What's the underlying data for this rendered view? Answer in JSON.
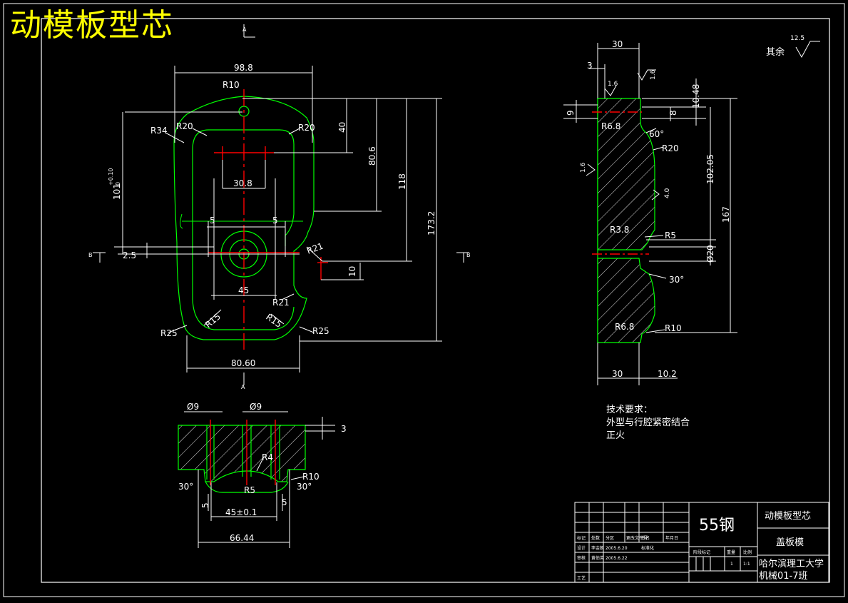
{
  "heading": "动模板型芯",
  "front_view": {
    "dims": {
      "width_top": "98.8",
      "r_top": "R10",
      "r34": "R34",
      "r20_left": "R20",
      "r20_right": "R20",
      "d40": "40",
      "d80_6": "80.6",
      "d118": "118",
      "d173_2": "173.2",
      "tol_height": "101",
      "tol_upper": "+0.10",
      "tol_lower": "0",
      "d30_8": "30.8",
      "d5_left": "5",
      "d5_right": "5",
      "d2_5": "2.5",
      "r21_upper": "R21",
      "d10": "10",
      "d45": "45",
      "r21_lower": "R21",
      "r15_left": "R15",
      "r15_right": "R15",
      "r25_left": "R25",
      "r25_right": "R25",
      "width_bottom": "80.60"
    },
    "section_marks": {
      "top": "A",
      "bottom": "A",
      "left": "B",
      "right": "B"
    }
  },
  "bottom_view": {
    "dims": {
      "dia9_left": "Ø9",
      "dia9_right": "Ø9",
      "d3": "3",
      "r4": "R4",
      "r5": "R5",
      "r10": "R10",
      "angle_left": "30°",
      "angle_right": "30°",
      "d5_left": "5",
      "d5_right": "5",
      "d45_tol": "45±0.1",
      "d66_44": "66.44"
    }
  },
  "side_view": {
    "dims": {
      "d30_top": "30",
      "d3": "3",
      "rough_1_6_top": "1.6",
      "rough_1_6_left": "1.6",
      "rough_1_6_right": "1.6",
      "rough_4_0": "4.0",
      "d9": "9",
      "d8": "8",
      "d10_48": "10.48",
      "r6_8_top": "R6.8",
      "angle_60": "60°",
      "r20": "R20",
      "d102_05": "102.05",
      "d167": "167",
      "r3_8": "R3.8",
      "r5": "R5",
      "dia20": "Ø20",
      "angle_30": "30°",
      "r6_8_bottom": "R6.8",
      "r10": "R10",
      "d30_bottom": "30",
      "d10_2": "10.2"
    },
    "general_roughness": {
      "label": "其余",
      "value": "12.5"
    }
  },
  "tech_requirements": {
    "title": "技术要求：",
    "lines": [
      "外型与行腔紧密结合",
      "正火"
    ]
  },
  "title_block": {
    "material": "55钢",
    "part_name": "动模板型芯",
    "assembly": "盖板模",
    "school": "哈尔滨理工大学",
    "class_name": "机械01-7班",
    "header_labels": [
      "标记",
      "处数",
      "分区",
      "更改文件号",
      "签名",
      "年月日"
    ],
    "design_label": "设计",
    "designer": "李金朝",
    "design_date": "2005.6.20",
    "standard_label": "标准化",
    "check_label": "审核",
    "checker": "黄伯英",
    "check_date": "2005.6.22",
    "process_label": "工艺",
    "stage_label": "阶段标记",
    "weight_label": "重量",
    "scale_label": "比例",
    "quantity": "1",
    "scale": "1:1"
  },
  "colors": {
    "background": "#000000",
    "outline": "#00ff00",
    "center_line": "#ff0000",
    "dimension": "#ffffff",
    "heading": "#ffff00"
  }
}
